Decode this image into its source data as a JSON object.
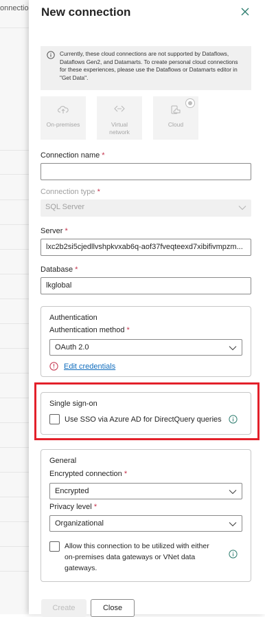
{
  "background": {
    "header_text": "onnectio"
  },
  "panel": {
    "title": "New connection",
    "notice": "Currently, these cloud connections are not supported by Dataflows, Dataflows Gen2, and Datamarts. To create personal cloud connections for these experiences, please use the Dataflows or Datamarts editor in \"Get Data\".",
    "tiles": [
      {
        "line1": "On-premises",
        "line2": ""
      },
      {
        "line1": "Virtual",
        "line2": "network"
      },
      {
        "line1": "Cloud",
        "line2": ""
      }
    ]
  },
  "form": {
    "connection_name_label": "Connection name",
    "connection_name_value": "",
    "connection_type_label": "Connection type",
    "connection_type_value": "SQL Server",
    "server_label": "Server",
    "server_value": "lxc2b2si5cjedllvshpkvxab6q-aof37fveqteexd7xibifivmpzm...",
    "database_label": "Database",
    "database_value": "lkglobal",
    "required_mark": "*"
  },
  "authentication": {
    "title": "Authentication",
    "method_label": "Authentication method",
    "method_value": "OAuth 2.0",
    "edit_link": "Edit credentials"
  },
  "sso": {
    "title": "Single sign-on",
    "checkbox_label": "Use SSO via Azure AD for DirectQuery queries"
  },
  "general": {
    "title": "General",
    "encrypted_label": "Encrypted connection",
    "encrypted_value": "Encrypted",
    "privacy_label": "Privacy level",
    "privacy_value": "Organizational",
    "gateway_line1": "Allow this connection to be utilized with either",
    "gateway_line2": "on-premises data gateways or VNet data",
    "gateway_line3": "gateways."
  },
  "buttons": {
    "create": "Create",
    "close": "Close"
  },
  "colors": {
    "accent": "#0f6cbd",
    "required": "#c4314b",
    "highlight": "#e3202a",
    "close_icon": "#2e7d6f"
  }
}
